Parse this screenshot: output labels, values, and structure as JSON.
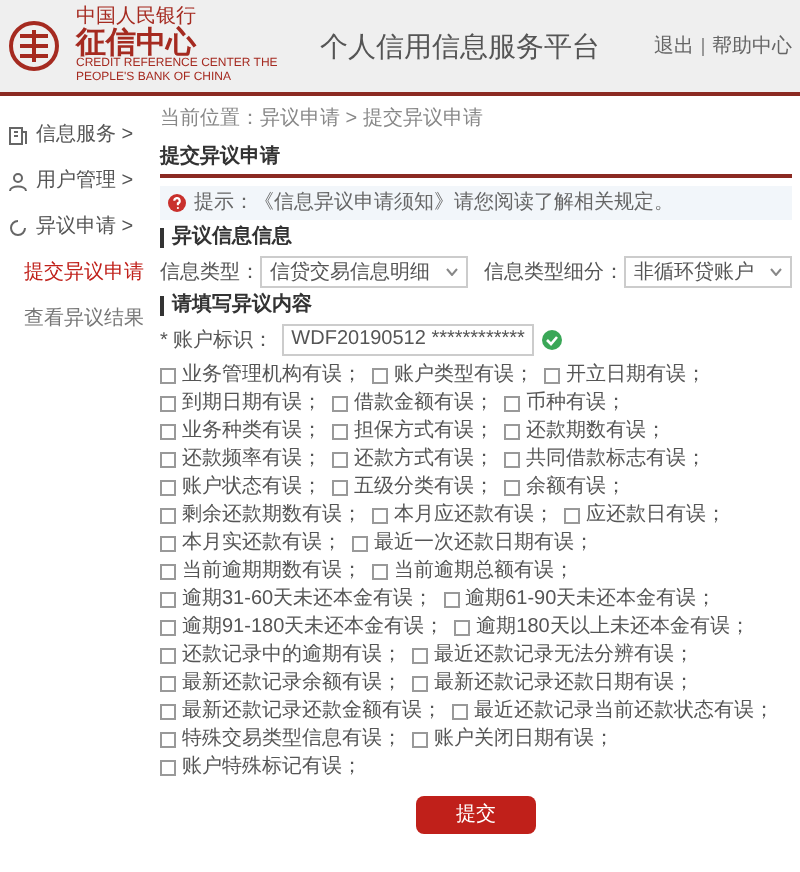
{
  "header": {
    "logo_top": "中国人民银行",
    "logo_name": "征信中心",
    "logo_en": "CREDIT REFERENCE CENTER THE PEOPLE'S BANK OF CHINA",
    "title": "个人信用信息服务平台",
    "links": [
      "退出",
      "帮助中心"
    ]
  },
  "sidebar": {
    "items": [
      {
        "label": "信息服务 >",
        "kind": "doc"
      },
      {
        "label": "用户管理 >",
        "kind": "user"
      },
      {
        "label": "异议申请 >",
        "kind": "cycle",
        "children": [
          {
            "label": "提交异议申请",
            "selected": true
          },
          {
            "label": "查看异议结果",
            "selected": false
          }
        ]
      }
    ]
  },
  "breadcrumb": "当前位置：异议申请 > 提交异议申请",
  "page_title": "提交异议申请",
  "notice": "提示：《信息异议申请须知》请您阅读了解相关规定。",
  "section_1": "异议信息信息",
  "selects": [
    {
      "label": "信息类型：",
      "value": "信贷交易信息明细"
    },
    {
      "label": "信息类型细分：",
      "value": "非循环贷账户"
    }
  ],
  "section_2": "请填写异议内容",
  "account": {
    "label": "* 账户标识：",
    "value": "WDF20190512 ************",
    "valid": true
  },
  "options": [
    {
      "label": "业务管理机构有误；",
      "checked": false
    },
    {
      "label": "账户类型有误；",
      "checked": false
    },
    {
      "label": "开立日期有误；",
      "checked": false
    },
    {
      "label": "到期日期有误；",
      "checked": false
    },
    {
      "label": "借款金额有误；",
      "checked": false
    },
    {
      "label": "币种有误；",
      "checked": false
    },
    {
      "label": "业务种类有误；",
      "checked": false
    },
    {
      "label": "担保方式有误；",
      "checked": false
    },
    {
      "label": "还款期数有误；",
      "checked": false
    },
    {
      "label": "还款频率有误；",
      "checked": false
    },
    {
      "label": "还款方式有误；",
      "checked": false
    },
    {
      "label": "共同借款标志有误；",
      "checked": false
    },
    {
      "label": "账户状态有误；",
      "checked": false
    },
    {
      "label": "五级分类有误；",
      "checked": false
    },
    {
      "label": "余额有误；",
      "checked": false
    },
    {
      "label": "剩余还款期数有误；",
      "checked": false
    },
    {
      "label": "本月应还款有误；",
      "checked": false
    },
    {
      "label": "应还款日有误；",
      "checked": false
    },
    {
      "label": "本月实还款有误；",
      "checked": false
    },
    {
      "label": "最近一次还款日期有误；",
      "checked": false
    },
    {
      "label": "当前逾期期数有误；",
      "checked": false
    },
    {
      "label": "当前逾期总额有误；",
      "checked": false
    },
    {
      "label": "逾期31-60天未还本金有误；",
      "checked": false
    },
    {
      "label": "逾期61-90天未还本金有误；",
      "checked": false
    },
    {
      "label": "逾期91-180天未还本金有误；",
      "checked": false
    },
    {
      "label": "逾期180天以上未还本金有误；",
      "checked": false
    },
    {
      "label": "还款记录中的逾期有误；",
      "checked": false
    },
    {
      "label": "最近还款记录无法分辨有误；",
      "checked": false
    },
    {
      "label": "最新还款记录余额有误；",
      "checked": false
    },
    {
      "label": "最新还款记录还款日期有误；",
      "checked": false
    },
    {
      "label": "最新还款记录还款金额有误；",
      "checked": false
    },
    {
      "label": "最近还款记录当前还款状态有误；",
      "checked": false
    },
    {
      "label": "特殊交易类型信息有误；",
      "checked": false
    },
    {
      "label": "账户关闭日期有误；",
      "checked": false
    },
    {
      "label": "账户特殊标记有误；",
      "checked": false
    }
  ],
  "submit": "提交"
}
